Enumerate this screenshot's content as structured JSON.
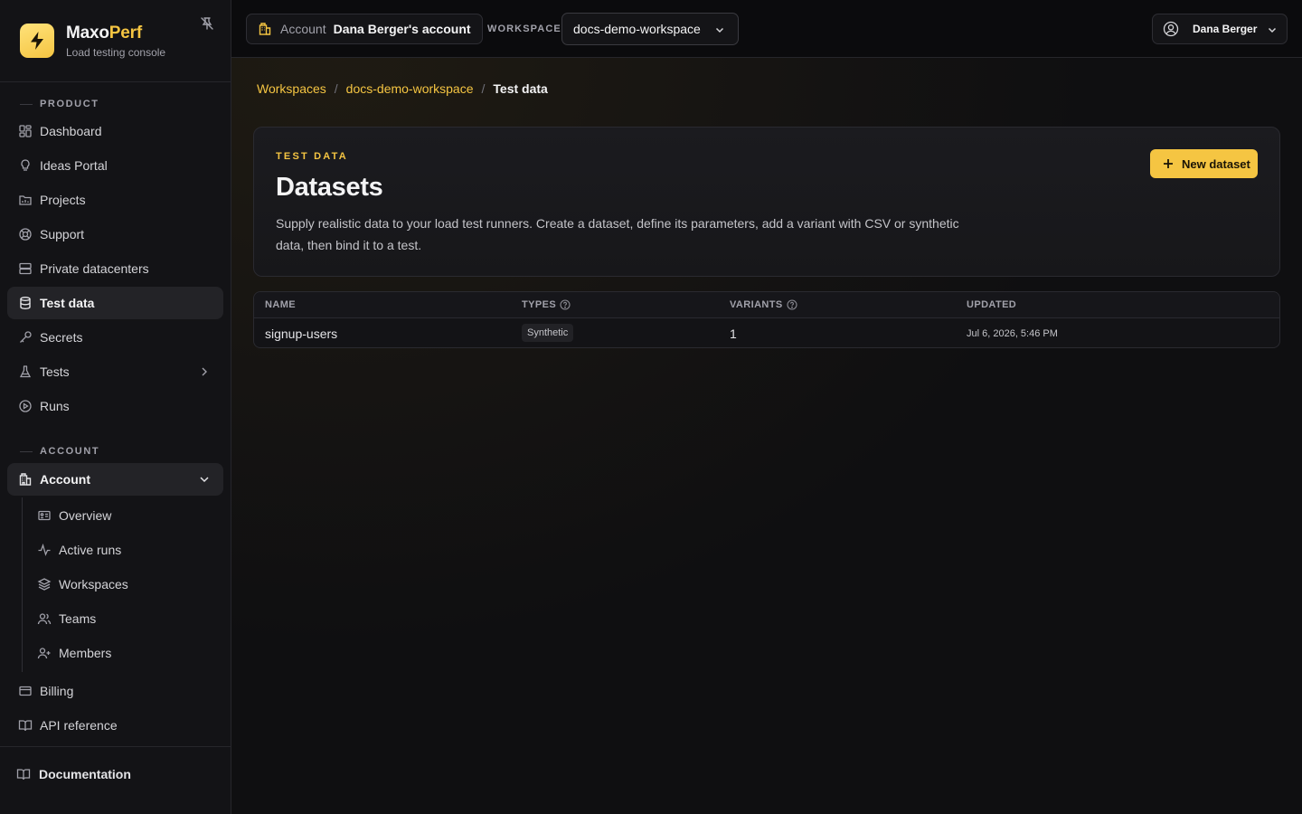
{
  "brand": {
    "name_main": "Maxo",
    "name_accent": "Perf",
    "subtitle": "Load testing console"
  },
  "sidebar": {
    "product_label": "PRODUCT",
    "product_items": [
      {
        "label": "Dashboard",
        "icon": "dashboard-icon"
      },
      {
        "label": "Ideas Portal",
        "icon": "lightbulb-icon"
      },
      {
        "label": "Projects",
        "icon": "folder-icon"
      },
      {
        "label": "Support",
        "icon": "lifebuoy-icon"
      },
      {
        "label": "Private datacenters",
        "icon": "server-icon"
      },
      {
        "label": "Test data",
        "icon": "database-icon",
        "active": true
      },
      {
        "label": "Secrets",
        "icon": "key-icon"
      },
      {
        "label": "Tests",
        "icon": "flask-icon"
      },
      {
        "label": "Runs",
        "icon": "play-circle-icon"
      }
    ],
    "account_label": "ACCOUNT",
    "account_group": {
      "label": "Account",
      "icon": "building-icon",
      "expanded": true
    },
    "account_items": [
      {
        "label": "Overview",
        "icon": "id-card-icon"
      },
      {
        "label": "Active runs",
        "icon": "activity-icon"
      },
      {
        "label": "Workspaces",
        "icon": "layers-icon"
      },
      {
        "label": "Teams",
        "icon": "users-icon"
      },
      {
        "label": "Members",
        "icon": "user-plus-icon"
      }
    ],
    "bottom_items": [
      {
        "label": "Billing",
        "icon": "credit-card-icon"
      },
      {
        "label": "API reference",
        "icon": "book-open-icon"
      }
    ],
    "footer_link": "Documentation"
  },
  "topbar": {
    "account_label": "Account",
    "account_value": "Dana Berger's account",
    "workspace_label": "WORKSPACE",
    "workspace_value": "docs-demo-workspace",
    "user_name": "Dana Berger"
  },
  "breadcrumb": [
    "Workspaces",
    "docs-demo-workspace",
    "Test data"
  ],
  "hero": {
    "eyebrow": "TEST DATA",
    "title": "Datasets",
    "description": "Supply realistic data to your load test runners. Create a dataset, define its parameters, add a variant with CSV or synthetic data, then bind it to a test.",
    "new_button": "New dataset"
  },
  "table": {
    "columns": [
      "NAME",
      "TYPES",
      "VARIANTS",
      "UPDATED"
    ],
    "rows": [
      {
        "name": "signup-users",
        "type": "Synthetic",
        "variants": "1",
        "updated": "Jul 6, 2026, 5:46 PM"
      }
    ]
  },
  "colors": {
    "accent": "#f5c542",
    "background": "#0f0f11",
    "sidebar": "#131316"
  }
}
